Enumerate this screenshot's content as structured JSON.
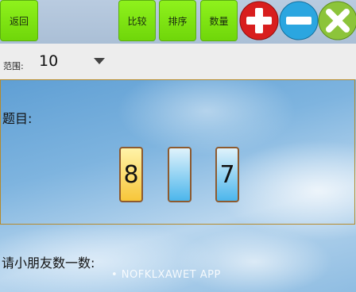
{
  "toolbar": {
    "back_label": "返回",
    "compare_label": "比较",
    "sort_label": "排序",
    "count_label": "数量",
    "plus_icon": "plus-icon",
    "minus_icon": "minus-icon",
    "close_icon": "close-icon"
  },
  "range": {
    "label": "范围:",
    "value": "10"
  },
  "question": {
    "label": "题目:",
    "cards": [
      {
        "value": "8",
        "color": "yellow"
      },
      {
        "value": "",
        "color": "blue"
      },
      {
        "value": "7",
        "color": "blue"
      }
    ]
  },
  "prompt": {
    "label": "请小朋友数一数:"
  },
  "watermark": "• NOFKLXAWET APP",
  "colors": {
    "button_green": "#7ce114",
    "plus_red": "#d81e1e",
    "minus_blue": "#2ba6e0",
    "close_green": "#8cc43a",
    "card_yellow": "#f7c63a",
    "card_blue": "#4cb6ec",
    "card_border": "#8d5a2f",
    "frame_gold": "#b58a2c"
  }
}
